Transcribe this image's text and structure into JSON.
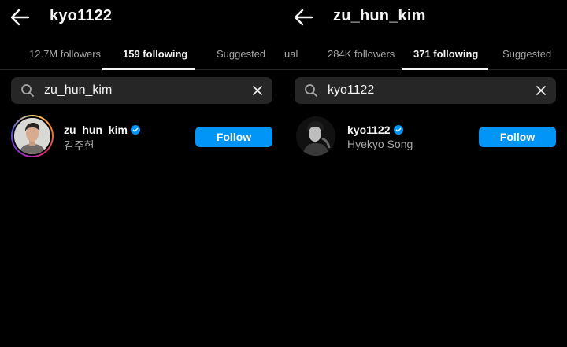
{
  "colors": {
    "background": "#000000",
    "accent": "#0095f6",
    "muted": "#a8a8a8",
    "search_bg": "#262626",
    "verified": "#0095f6"
  },
  "left": {
    "title": "kyo1122",
    "tabs": [
      {
        "label": "12.7M followers"
      },
      {
        "label": "159 following"
      },
      {
        "label": "Suggested"
      }
    ],
    "active_tab": 1,
    "search": {
      "value": "zu_hun_kim"
    },
    "result": {
      "username": "zu_hun_kim",
      "full_name": "김주헌",
      "follow_label": "Follow",
      "verified": true
    }
  },
  "right": {
    "title": "zu_hun_kim",
    "tabs": [
      {
        "label": "ual"
      },
      {
        "label": "284K followers"
      },
      {
        "label": "371 following"
      },
      {
        "label": "Suggested"
      }
    ],
    "active_tab": 2,
    "search": {
      "value": "kyo1122"
    },
    "result": {
      "username": "kyo1122",
      "full_name": "Hyekyo Song",
      "follow_label": "Follow",
      "verified": true
    }
  }
}
